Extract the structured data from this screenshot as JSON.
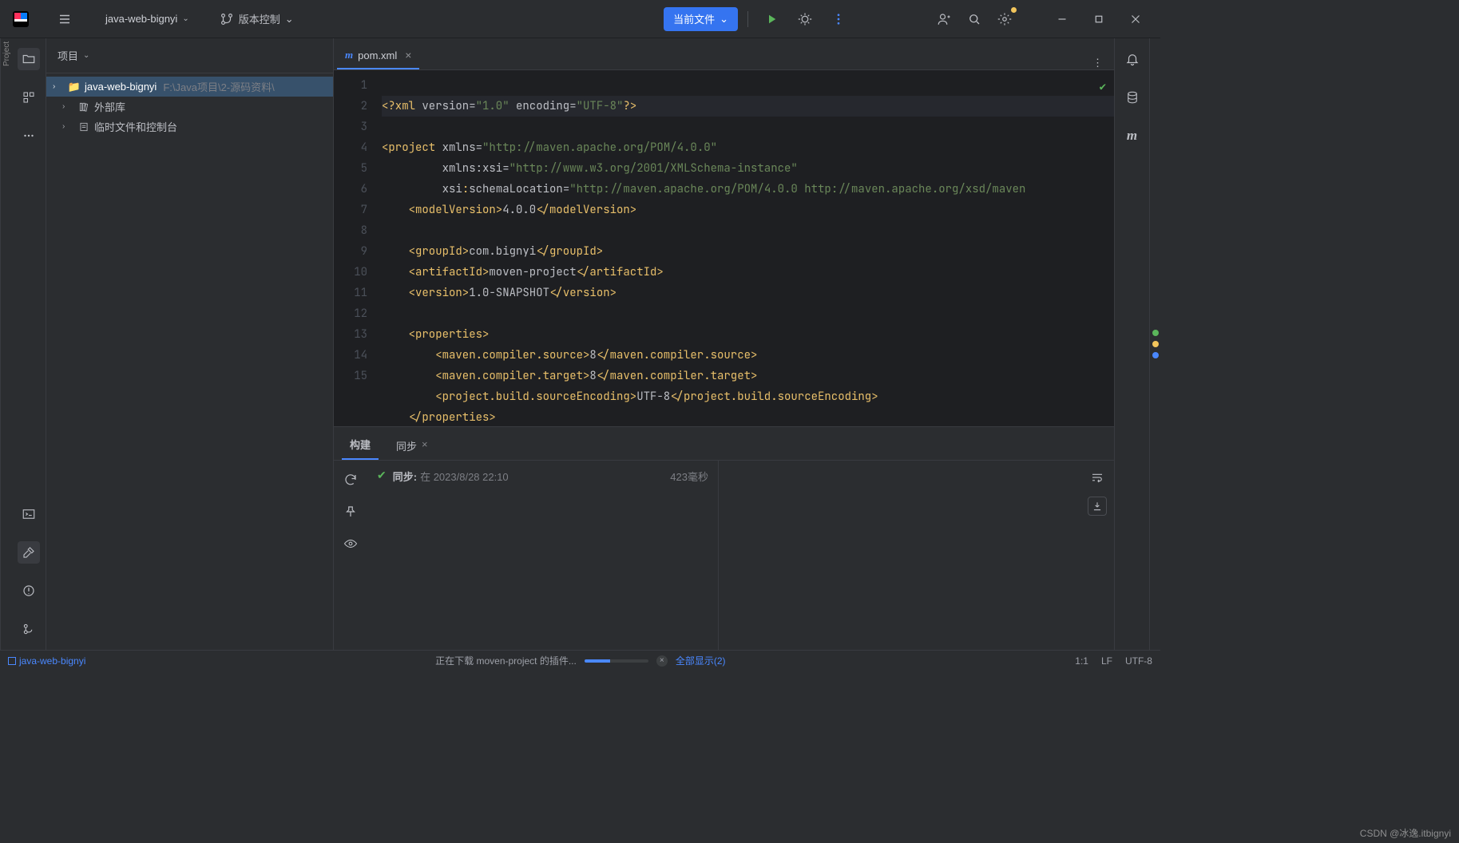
{
  "titlebar": {
    "project_name": "java-web-bignyi",
    "version_control": "版本控制",
    "run_current": "当前文件"
  },
  "left_panel": {
    "header": "项目",
    "tree": {
      "root": {
        "name": "java-web-bignyi",
        "path": "F:\\Java项目\\2-源码资料\\"
      },
      "ext_lib": "外部库",
      "scratches": "临时文件和控制台"
    }
  },
  "editor": {
    "tab_label": "pom.xml",
    "gutter": [
      "1",
      "2",
      "3",
      "4",
      "5",
      "6",
      "7",
      "8",
      "9",
      "10",
      "11",
      "12",
      "13",
      "14",
      "15"
    ]
  },
  "code": {
    "l1_a": "<?xml",
    "l1_b": " version",
    "l1_c": "=",
    "l1_d": "\"1.0\"",
    "l1_e": " encoding",
    "l1_f": "=",
    "l1_g": "\"UTF-8\"",
    "l1_h": "?>",
    "l2_a": "<project",
    "l2_b": " xmlns",
    "l2_c": "=",
    "l2_d": "\"http://maven.apache.org/POM/4.0.0\"",
    "l3_a": "         xmlns:xsi",
    "l3_b": "=",
    "l3_c": "\"http://www.w3.org/2001/XMLSchema-instance\"",
    "l4_a": "         xsi",
    "l4_b": ":",
    "l4_c": "schemaLocation",
    "l4_d": "=",
    "l4_e": "\"http://maven.apache.org/POM/4.0.0 http://maven.apache.org/xsd/maven",
    "l5_a": "    <modelVersion>",
    "l5_b": "4.0.0",
    "l5_c": "</modelVersion>",
    "l7_a": "    <groupId>",
    "l7_b": "com.bignyi",
    "l7_c": "</groupId>",
    "l8_a": "    <artifactId>",
    "l8_b": "moven-project",
    "l8_c": "</artifactId>",
    "l9_a": "    <version>",
    "l9_b": "1.0-SNAPSHOT",
    "l9_c": "</version>",
    "l11_a": "    <properties>",
    "l12_a": "        <maven.compiler.source>",
    "l12_b": "8",
    "l12_c": "</maven.compiler.source>",
    "l13_a": "        <maven.compiler.target>",
    "l13_b": "8",
    "l13_c": "</maven.compiler.target>",
    "l14_a": "        <project.build.sourceEncoding>",
    "l14_b": "UTF-8",
    "l14_c": "</project.build.sourceEncoding>",
    "l15_a": "    </properties>"
  },
  "build_panel": {
    "tab_build": "构建",
    "tab_sync": "同步",
    "sync_label": "同步:",
    "sync_time": "在 2023/8/28 22:10",
    "sync_dur": "423毫秒"
  },
  "statusbar": {
    "module": "java-web-bignyi",
    "progress_text": "正在下载 moven-project 的插件...",
    "show_all": "全部显示(2)",
    "pos": "1:1",
    "eol": "LF",
    "enc": "UTF-8",
    "watermark": "CSDN @冰逸.itbignyi"
  }
}
